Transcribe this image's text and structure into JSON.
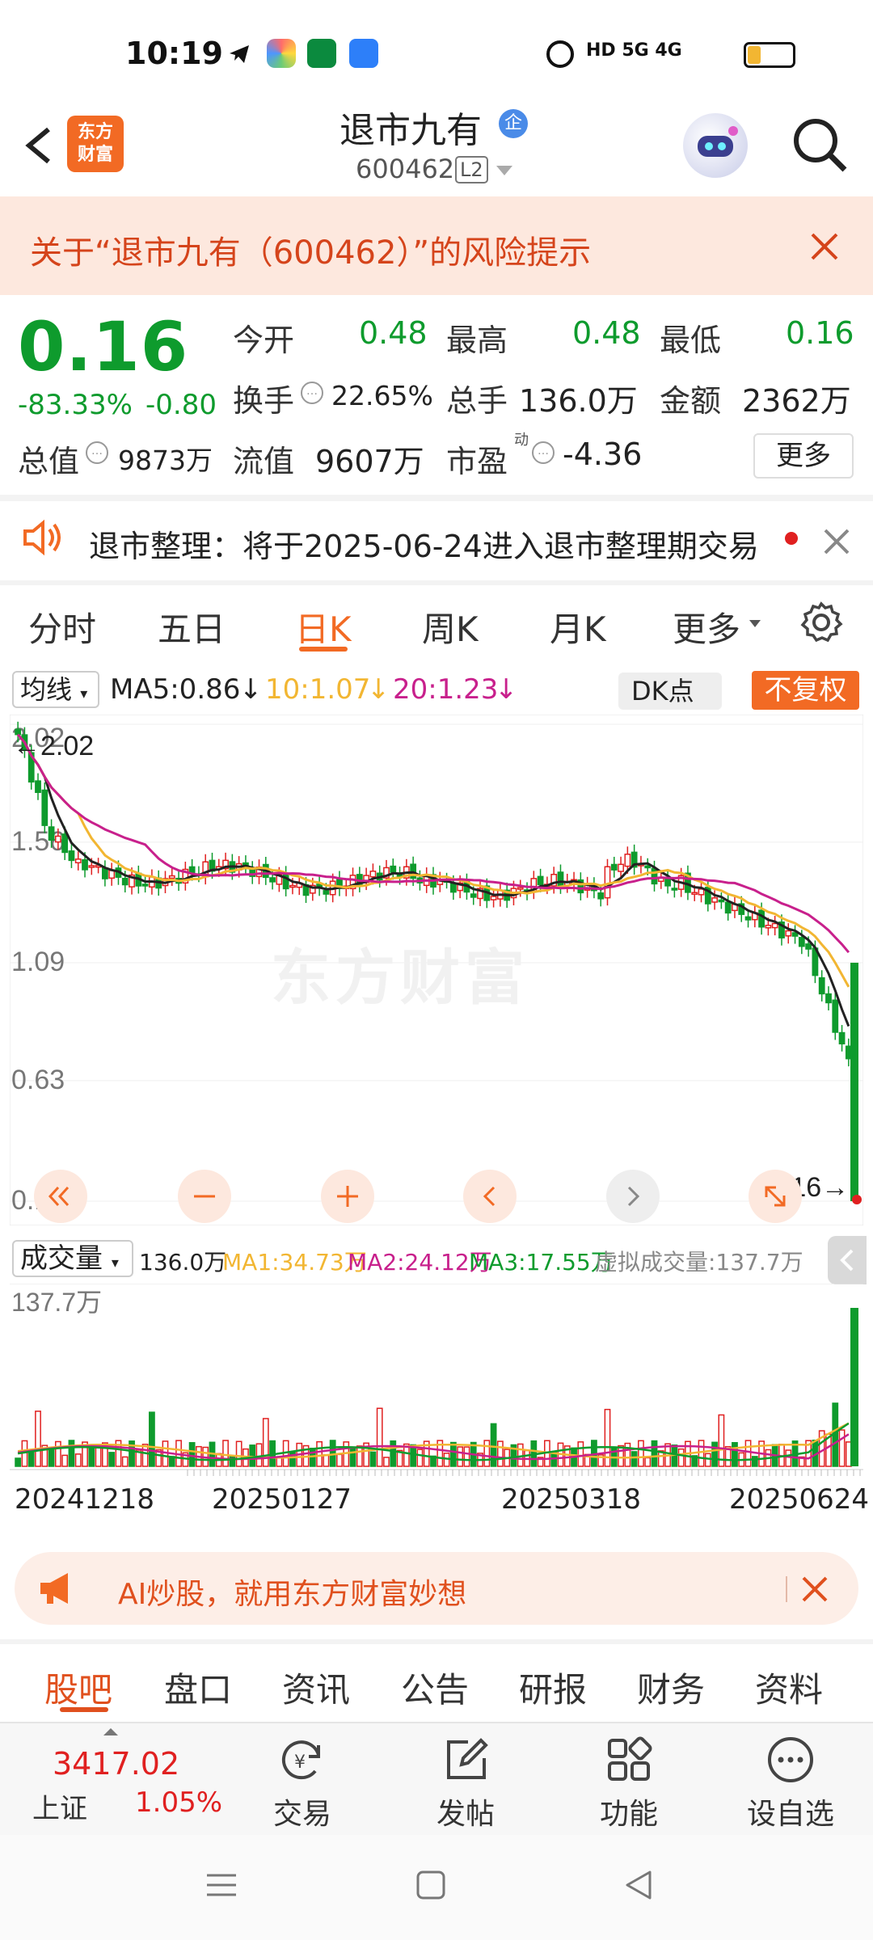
{
  "status_bar": {
    "time": "10:19",
    "right_text": "HD 5G 4G"
  },
  "header": {
    "logo_text_line1": "东方",
    "logo_text_line2": "财富",
    "stock_name": "退市九有",
    "name_badge": "企",
    "stock_code": "600462",
    "level_badge": "L2"
  },
  "risk_banner": {
    "text": "关于“退市九有（600462）”的风险提示"
  },
  "quote": {
    "price": "0.16",
    "change_pct": "-83.33%",
    "change_amt": "-0.80",
    "open_label": "今开",
    "open": "0.48",
    "high_label": "最高",
    "high": "0.48",
    "low_label": "最低",
    "low": "0.16",
    "turnover_label": "换手",
    "turnover": "22.65%",
    "volume_label": "总手",
    "volume": "136.0万",
    "amount_label": "金额",
    "amount": "2362万",
    "mktcap_label": "总值",
    "mktcap": "9873万",
    "float_label": "流值",
    "float_cap": "9607万",
    "pe_label": "市盈",
    "pe_sup": "动",
    "pe": "-4.36",
    "more_label": "更多"
  },
  "notice": {
    "text": "退市整理：将于2025-06-24进入退市整理期交易"
  },
  "period_tabs": {
    "items": [
      "分时",
      "五日",
      "日K",
      "周K",
      "月K",
      "更多"
    ],
    "active": "日K"
  },
  "ma_row": {
    "select_label": "均线",
    "ma5": "MA5:0.86",
    "ma10": "10:1.07",
    "ma20": "20:1.23",
    "dk_label": "DK点",
    "adjust_label": "不复权",
    "colors": {
      "ma5": "#222222",
      "ma10": "#f2b632",
      "ma20": "#c8208c"
    }
  },
  "kline": {
    "axis_labels": [
      "2.02",
      "1.56",
      "1.09",
      "0.63",
      "0.16"
    ],
    "max_marker": "2.02",
    "min_marker": "0.16",
    "watermark": "东方财富",
    "colors": {
      "up": "#e02020",
      "down": "#0e9b2d"
    }
  },
  "volume": {
    "select_label": "成交量",
    "current": "136.0万",
    "ma1": "MA1:34.73万",
    "ma2": "MA2:24.12万",
    "ma3": "MA3:17.55万",
    "virtual": "虚拟成交量:137.7万",
    "axis_max": "137.7万",
    "dates": [
      "20241218",
      "20250127",
      "20250318",
      "20250624"
    ]
  },
  "ai_banner": {
    "text": "AI炒股，就用东方财富妙想"
  },
  "bottom_tabs": {
    "items": [
      "股吧",
      "盘口",
      "资讯",
      "公告",
      "研报",
      "财务",
      "资料"
    ],
    "active": "股吧"
  },
  "bottom_bar": {
    "index_value": "3417.02",
    "index_name": "上证",
    "index_pct": "1.05%",
    "trade_label": "交易",
    "post_label": "发帖",
    "func_label": "功能",
    "watch_label": "设自选"
  }
}
